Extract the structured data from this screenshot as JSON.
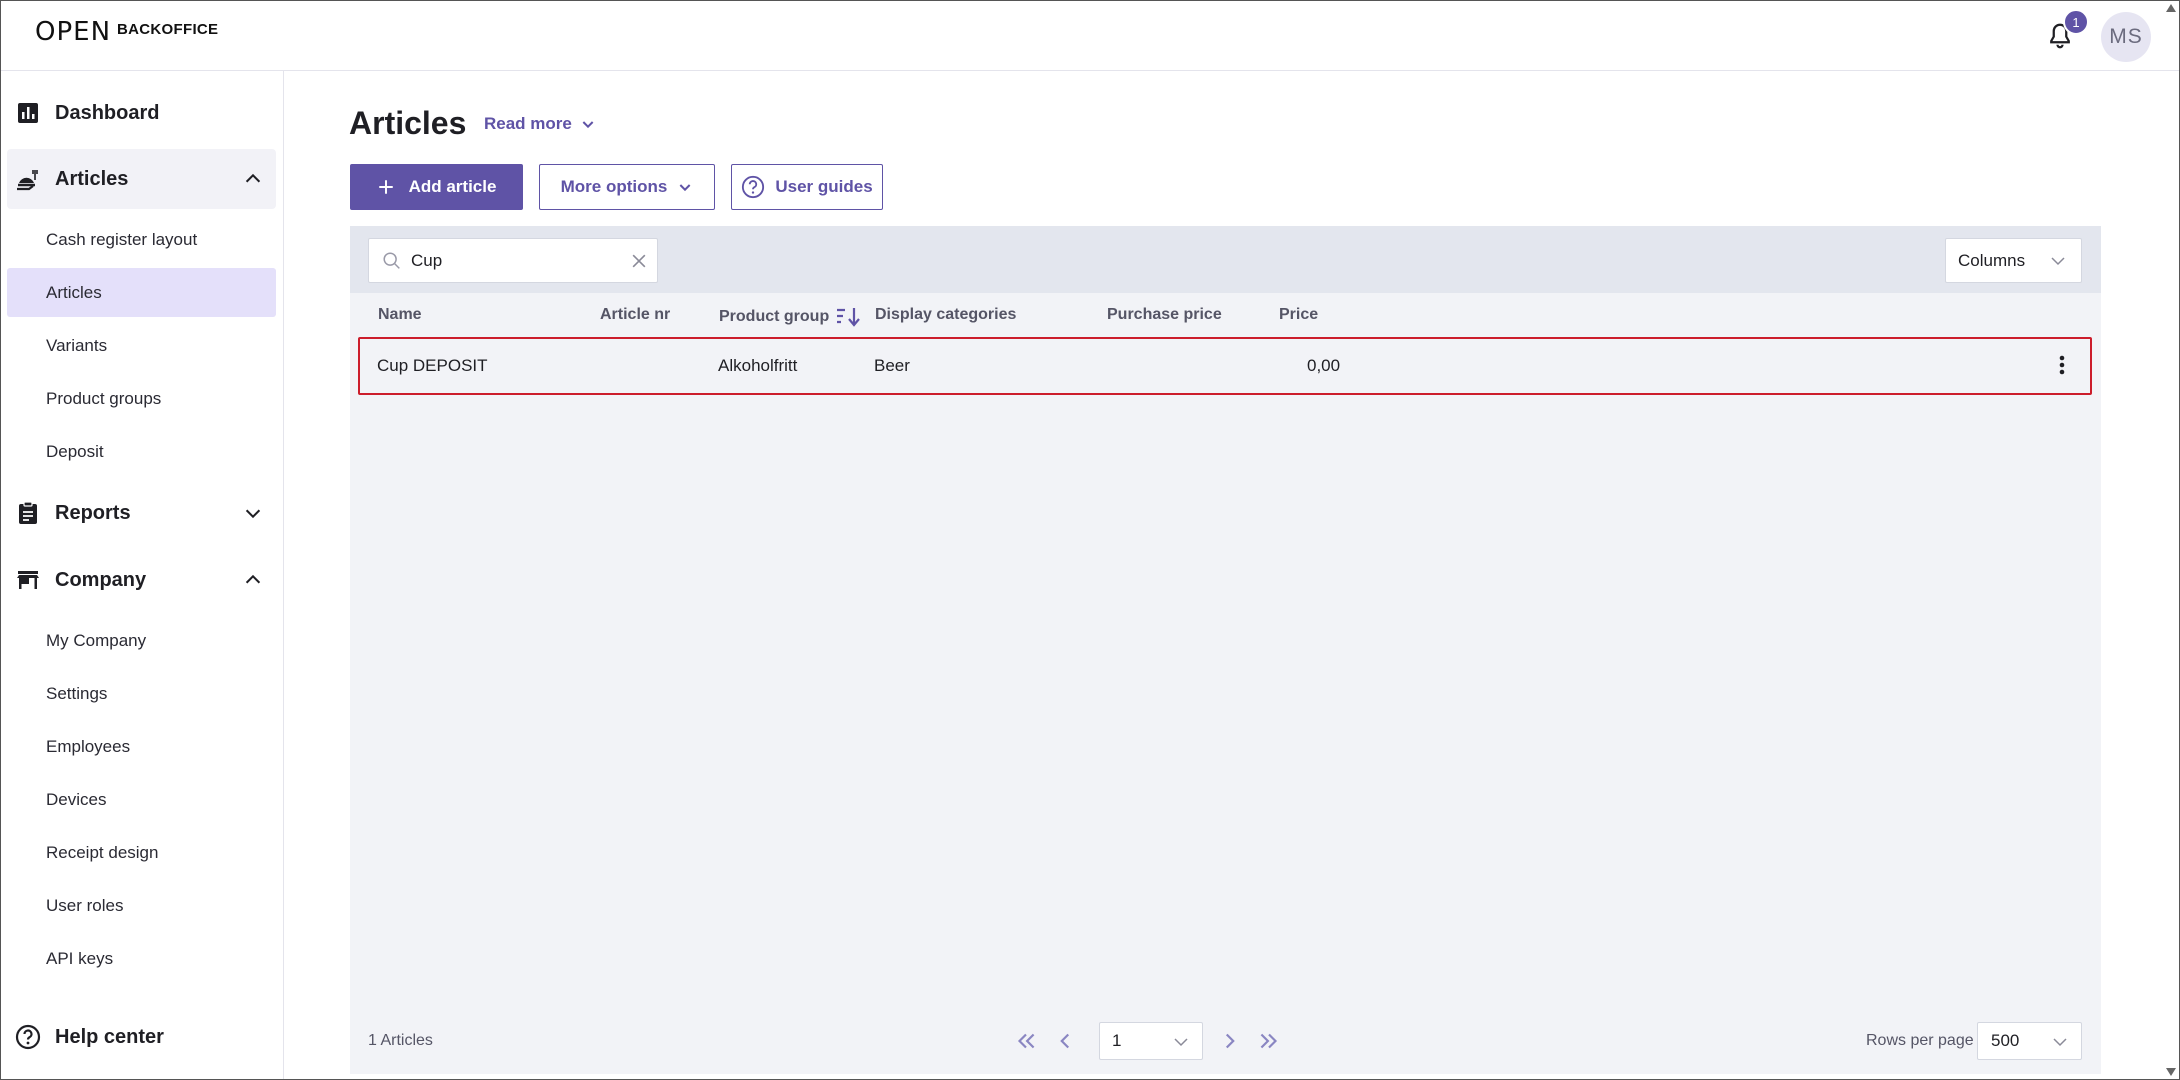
{
  "header": {
    "logo_mark": "OPEN",
    "logo_text": "BACKOFFICE",
    "notification_count": "1",
    "avatar_initials": "MS"
  },
  "sidebar": {
    "dashboard": "Dashboard",
    "articles_group": "Articles",
    "articles_items": [
      "Cash register layout",
      "Articles",
      "Variants",
      "Product groups",
      "Deposit"
    ],
    "reports_group": "Reports",
    "company_group": "Company",
    "company_items": [
      "My Company",
      "Settings",
      "Employees",
      "Devices",
      "Receipt design",
      "User roles",
      "API keys"
    ],
    "help_center": "Help center"
  },
  "main": {
    "title": "Articles",
    "read_more": "Read more",
    "add_article": "Add article",
    "more_options": "More options",
    "user_guides": "User guides"
  },
  "table": {
    "search_value": "Cup",
    "columns_label": "Columns",
    "headers": [
      "Name",
      "Article nr",
      "Product group",
      "Display categories",
      "Purchase price",
      "Price"
    ],
    "rows": [
      {
        "name": "Cup DEPOSIT",
        "article_nr": "",
        "product_group": "Alkoholfritt",
        "display_categories": "Beer",
        "purchase_price": "",
        "price": "0,00"
      }
    ],
    "count_label": "1 Articles",
    "current_page": "1",
    "rows_per_page_label": "Rows per page",
    "rows_per_page": "500"
  },
  "colors": {
    "accent": "#5f53a6",
    "selected_nav": "#e4e0fa",
    "highlight_border": "#cc1d2b"
  }
}
